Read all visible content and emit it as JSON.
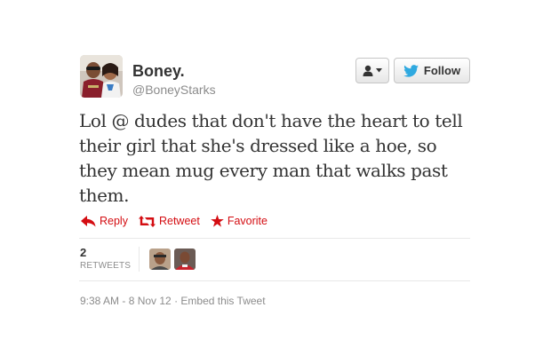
{
  "user": {
    "display_name": "Boney.",
    "screen_name": "@BoneyStarks",
    "avatar_icon": "profile-photo"
  },
  "header_buttons": {
    "user_menu_icon": "person-dropdown-icon",
    "follow_label": "Follow",
    "follow_icon": "twitter-bird-icon"
  },
  "tweet": {
    "text": "Lol @ dudes that don't have the heart to tell their girl that she's dressed like a hoe, so they mean mug every man that walks past them."
  },
  "actions": [
    {
      "label": "Reply",
      "icon": "reply-arrow-icon"
    },
    {
      "label": "Retweet",
      "icon": "retweet-icon"
    },
    {
      "label": "Favorite",
      "icon": "star-icon"
    }
  ],
  "stats": {
    "retweet_count": "2",
    "retweet_label": "RETWEETS"
  },
  "meta": {
    "timestamp": "9:38 AM - 8 Nov 12",
    "separator": " · ",
    "embed_label": "Embed this Tweet"
  },
  "colors": {
    "action_red": "#d40d12",
    "follow_bird_blue": "#2fa9e0",
    "muted_text": "#8c8c8c"
  }
}
